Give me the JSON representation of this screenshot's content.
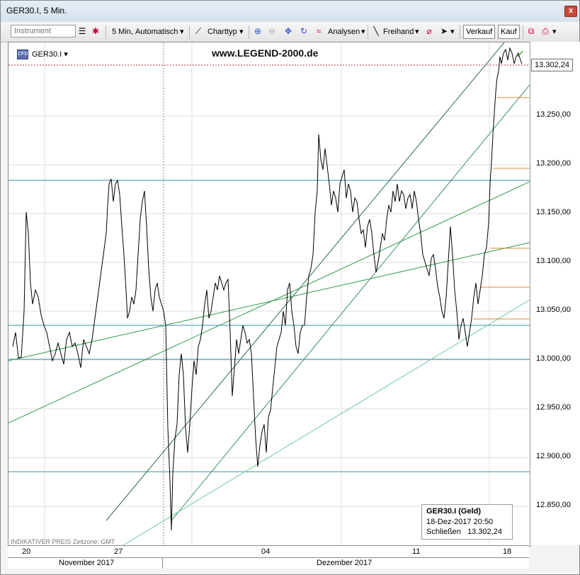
{
  "window": {
    "title": "GER30.I, 5 Min.",
    "close_label": "x"
  },
  "toolbar": {
    "instrument_placeholder": "Instrument",
    "interval_label": "5 Min,",
    "mode_label": "Automatisch",
    "charttype_label": "Charttyp",
    "analysen_label": "Analysen",
    "freihand_label": "Freihand",
    "sell_label": "Verkauf",
    "buy_label": "Kauf"
  },
  "chart": {
    "symbol": "GER30.I",
    "watermark": "www.LEGEND-2000.de",
    "indicative": "INDIKATIVER PREIS   Zeitzone: GMT",
    "current_price": "13.302,24",
    "colors": {
      "horizontal": "#3a8fa8",
      "green": "#2e9a4a",
      "dark_green": "#2b6b4e",
      "light_green": "#6fcf9a",
      "orange": "#d98a3a"
    },
    "info": {
      "name": "GER30.I (Geld)",
      "datetime": "18-Dez-2017 20:50",
      "close_label": "Schließen",
      "close_value": "13.302,24"
    },
    "y_ticks": [
      "13.250,00",
      "13.200,00",
      "13.150,00",
      "13.100,00",
      "13.050,00",
      "13.000,00",
      "12.950,00",
      "12.900,00",
      "12.850,00"
    ],
    "x_ticks": [
      "20",
      "27",
      "04",
      "11",
      "18"
    ],
    "months": [
      "November 2017",
      "Dezember 2017"
    ]
  }
}
